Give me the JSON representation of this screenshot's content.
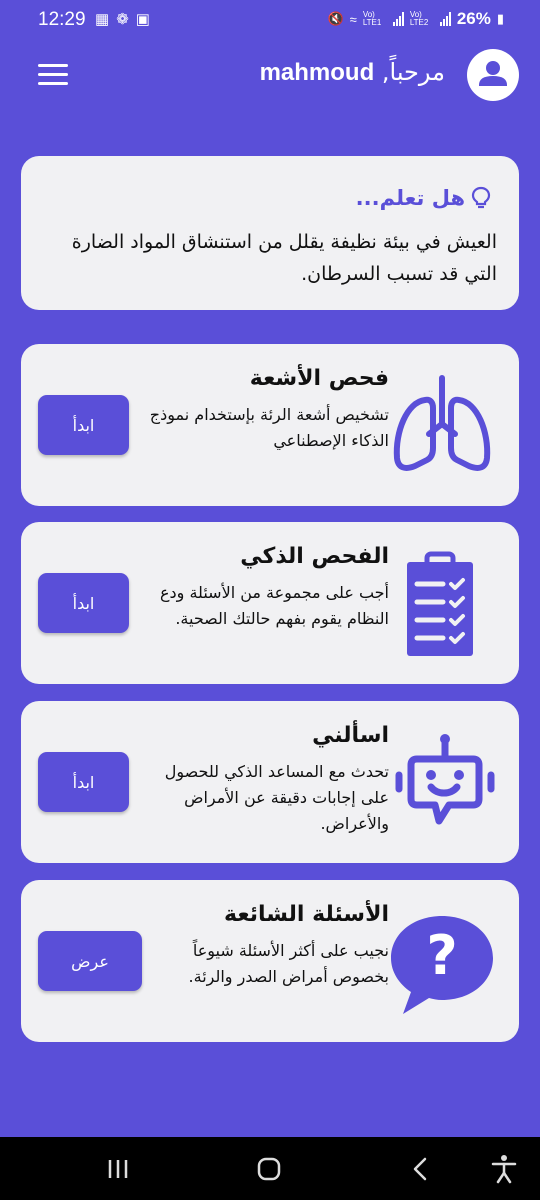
{
  "status_bar": {
    "time": "12:29",
    "battery": "26%",
    "network_label_1": "Vo) LTE1",
    "network_label_2": "Vo) LTE2"
  },
  "header": {
    "greeting_word": "مرحباً,",
    "username": "mahmoud",
    "avatar_icon": "user-icon",
    "menu_icon": "hamburger-menu-icon"
  },
  "tip": {
    "title": "هل تعلم...",
    "icon": "lightbulb-icon",
    "text": "العيش في بيئة نظيفة يقلل من استنشاق المواد الضارة التي قد تسبب السرطان."
  },
  "features": [
    {
      "title": "فحص الأشعة",
      "description": "تشخيص أشعة الرئة بإستخدام نموذج الذكاء الإصطناعي",
      "button": "ابدأ",
      "icon": "lungs-icon"
    },
    {
      "title": "الفحص الذكي",
      "description": "أجب على مجموعة من الأسئلة ودع النظام يقوم بفهم حالتك الصحية.",
      "button": "ابدأ",
      "icon": "checklist-clipboard-icon"
    },
    {
      "title": "اسألني",
      "description": "تحدث مع المساعد الذكي للحصول على إجابات دقيقة عن الأمراض والأعراض.",
      "button": "ابدأ",
      "icon": "chat-robot-icon"
    },
    {
      "title": "الأسئلة الشائعة",
      "description": "نجيب على أكثر الأسئلة شيوعاً بخصوص أمراض الصدر والرئة.",
      "button": "عرض",
      "icon": "question-speech-bubble-icon"
    }
  ],
  "colors": {
    "primary": "#5a4fd8",
    "card_bg": "#f1f1f3",
    "nav_bg": "#000000"
  }
}
